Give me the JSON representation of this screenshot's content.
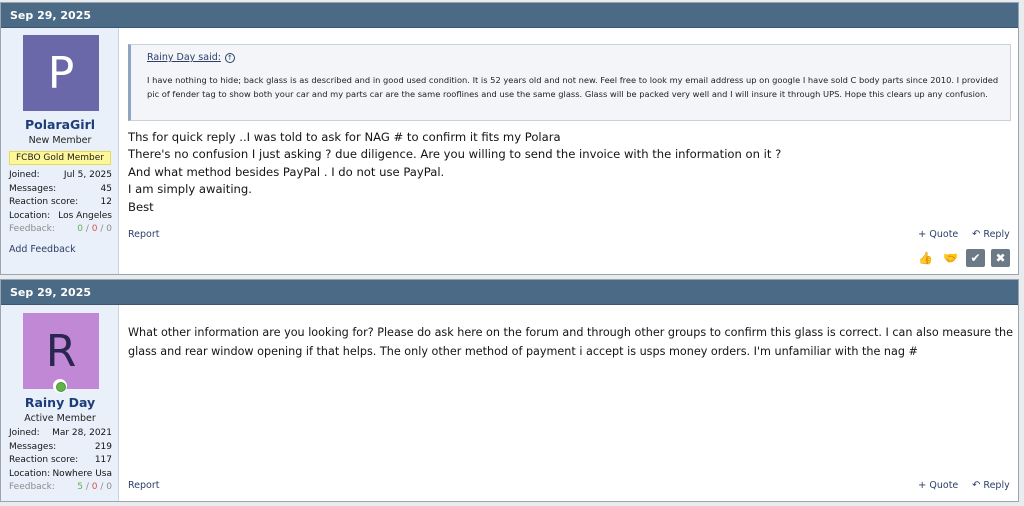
{
  "posts": [
    {
      "date": "Sep 29, 2025",
      "avatar_letter": "P",
      "username": "PolaraGirl",
      "user_title": "New Member",
      "badge": "FCBO Gold Member",
      "stats": [
        {
          "label": "Joined:",
          "value": "Jul 5, 2025"
        },
        {
          "label": "Messages:",
          "value": "45"
        },
        {
          "label": "Reaction score:",
          "value": "12"
        },
        {
          "label": "Location:",
          "value": "Los Angeles"
        }
      ],
      "feedback_label": "Feedback:",
      "feedback": {
        "pos": "0",
        "neu": "0",
        "neg": "0"
      },
      "add_feedback": "Add Feedback",
      "quote": {
        "author": "Rainy Day said:",
        "text": "I have nothing to hide; back glass is as described and in good used condition. It is 52 years old and not new. Feel free to look my email address up on google I have sold C body parts since 2010. I provided pic of fender tag to show both your car and my parts car are the same rooflines and use the same glass. Glass will be packed very well and I will insure it through UPS. Hope this clears up any confusion."
      },
      "message_lines": [
        "Ths for quick reply ..I was told to ask for NAG # to confirm it fits my Polara",
        "There's no confusion I just asking ? due diligence. Are you willing to send the invoice with the information on it ?",
        "And what method besides PayPal . I do not use PayPal.",
        "I am simply awaiting.",
        "Best"
      ],
      "report": "Report",
      "quote_label": "Quote",
      "reply_label": "Reply"
    },
    {
      "date": "Sep 29, 2025",
      "avatar_letter": "R",
      "username": "Rainy Day",
      "user_title": "Active Member",
      "stats": [
        {
          "label": "Joined:",
          "value": "Mar 28, 2021"
        },
        {
          "label": "Messages:",
          "value": "219"
        },
        {
          "label": "Reaction score:",
          "value": "117"
        },
        {
          "label": "Location:",
          "value": "Nowhere Usa"
        }
      ],
      "feedback_label": "Feedback:",
      "feedback": {
        "pos": "5",
        "neu": "0",
        "neg": "0"
      },
      "message": "What other information are you looking for? Please do ask here on the forum and through other groups to confirm this glass is correct. I can also measure the glass and rear window opening if that helps. The only other method of payment i accept is usps money orders. I'm unfamiliar with the nag #",
      "report": "Report",
      "quote_label": "Quote",
      "reply_label": "Reply"
    }
  ],
  "icons": {
    "quote": "plus-icon",
    "reply": "reply-arrow-icon",
    "reactions": [
      "thumbs-up-icon",
      "handshake-icon",
      "check-icon",
      "close-icon"
    ]
  }
}
